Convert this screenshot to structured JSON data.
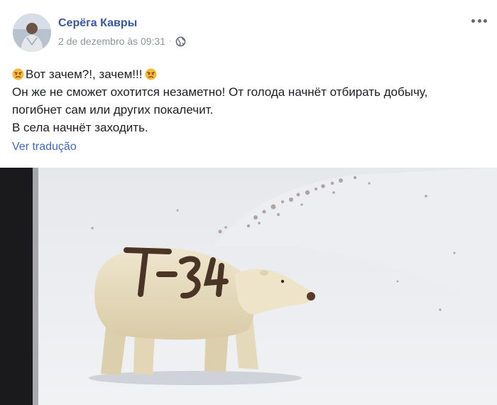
{
  "post": {
    "author_name": "Серёга Кавры",
    "timestamp": "2 de dezembro às 09:31",
    "separator": "·",
    "privacy_icon": "globe-icon",
    "more_icon": "more-horizontal-icon",
    "text_lines": [
      "Вот зачем?!, зачем!!!",
      "Он же не сможет охотится незаметно! От голода начнёт отбирать добычу,",
      "погибнет сам или других покалечит.",
      "В села начнёт заходить."
    ],
    "emoji_icon": "angry-face-icon",
    "translate_label": "Ver tradução",
    "photo": {
      "subject": "polar-bear-photo",
      "painted_marking": "T-34"
    }
  },
  "colors": {
    "author": "#385898",
    "link": "#4267b2",
    "meta": "#90949c",
    "text": "#1c1e21"
  }
}
